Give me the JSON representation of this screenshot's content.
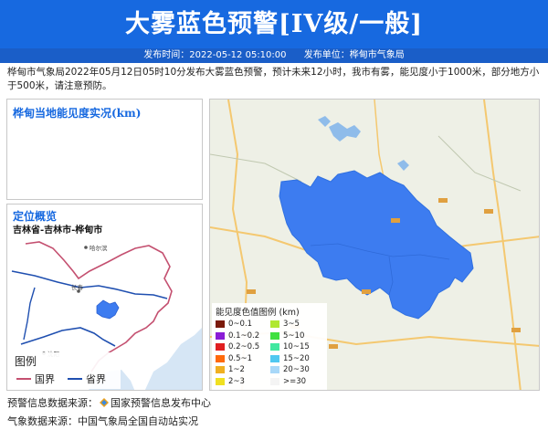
{
  "header": {
    "title": "大雾蓝色预警[IV级/一般]",
    "publish_time_label": "发布时间：2022-05-12 05:10:00",
    "publish_unit_label": "发布单位：桦甸市气象局"
  },
  "description": "桦甸市气象局2022年05月12日05时10分发布大雾蓝色预警，预计未来12小时，我市有雾，能见度小于1000米，部分地方小于500米，请注意预防。",
  "visibility_panel": {
    "title": "桦甸当地能见度实况(km)"
  },
  "location_panel": {
    "title": "定位概览",
    "subtitle": "吉林省-吉林市-桦甸市",
    "legend_title": "图例",
    "legend_items": [
      {
        "label": "国界",
        "color": "#c45070"
      },
      {
        "label": "省界",
        "color": "#1f4fb0"
      }
    ],
    "city_labels": [
      "哈尔滨",
      "长春",
      "沈阳"
    ]
  },
  "main_map": {
    "warning_area_color": "#3d7cf0",
    "legend": {
      "title": "能见度色值图例 (km)",
      "items": [
        {
          "label": "0~0.1",
          "color": "#7a1a0a"
        },
        {
          "label": "0.1~0.2",
          "color": "#8a1cd6"
        },
        {
          "label": "0.2~0.5",
          "color": "#e02020"
        },
        {
          "label": "0.5~1",
          "color": "#ff6a0a"
        },
        {
          "label": "1~2",
          "color": "#f0b020"
        },
        {
          "label": "2~3",
          "color": "#f0e020"
        },
        {
          "label": "3~5",
          "color": "#b0e830"
        },
        {
          "label": "5~10",
          "color": "#40e040"
        },
        {
          "label": "10~15",
          "color": "#40e8a0"
        },
        {
          "label": "15~20",
          "color": "#50c8f0"
        },
        {
          "label": "20~30",
          "color": "#a8d8f8"
        },
        {
          "label": ">=30",
          "color": "#f4f4f4"
        }
      ]
    }
  },
  "footer": {
    "warning_source_label": "预警信息数据来源：",
    "warning_source_name": "国家预警信息发布中心",
    "weather_source_label": "气象数据来源：",
    "weather_source_name": "中国气象局全国自动站实况"
  },
  "colors": {
    "header_bg": "#1769e0",
    "meta_bar_bg": "#1a5ec8",
    "panel_title": "#1769e0"
  }
}
